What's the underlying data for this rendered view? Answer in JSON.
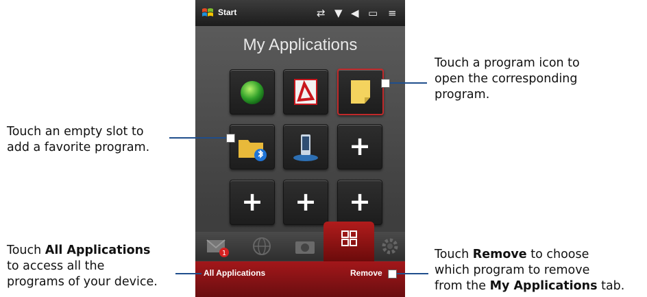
{
  "phone": {
    "status": {
      "start_label": "Start"
    },
    "title": "My Applications",
    "slots": [
      {
        "icon": "green-orb-icon",
        "empty": false
      },
      {
        "icon": "adobe-reader-icon",
        "empty": false
      },
      {
        "icon": "sticky-note-icon",
        "empty": false,
        "selected": true
      },
      {
        "icon": "bluetooth-folder-icon",
        "empty": false
      },
      {
        "icon": "phone-sync-icon",
        "empty": false
      },
      {
        "icon": "plus-icon",
        "empty": true,
        "label": "+"
      },
      {
        "icon": "plus-icon",
        "empty": true,
        "label": "+"
      },
      {
        "icon": "plus-icon",
        "empty": true,
        "label": "+"
      },
      {
        "icon": "plus-icon",
        "empty": true,
        "label": "+"
      }
    ],
    "tabs": [
      {
        "icon": "mail-icon",
        "badge": "1"
      },
      {
        "icon": "globe-icon"
      },
      {
        "icon": "camera-icon"
      },
      {
        "icon": "grid-icon",
        "active": true
      },
      {
        "icon": "settings-icon"
      }
    ],
    "softkeys": {
      "left": "All Applications",
      "right": "Remove"
    }
  },
  "callouts": {
    "program_icon": "Touch a program icon to open the corresponding program.",
    "program_icon_lines": [
      "Touch a program icon to",
      "open the corresponding",
      "program."
    ],
    "empty_slot_lines": [
      "Touch an empty slot to",
      "add a favorite program."
    ],
    "all_apps": {
      "prefix": "Touch ",
      "bold": "All Applications",
      "line2": "to access all the",
      "line3": "programs of your device."
    },
    "remove": {
      "prefix": "Touch ",
      "bold": "Remove",
      "suffix": " to choose",
      "line2": "which program to remove",
      "line3_prefix": "from the ",
      "line3_bold": "My Applications",
      "line3_suffix": " tab."
    }
  }
}
